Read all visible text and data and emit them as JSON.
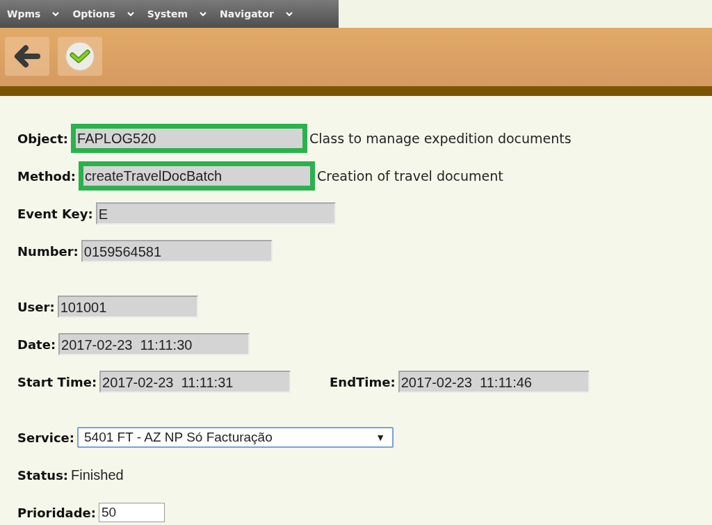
{
  "menu": [
    {
      "label": "Wpms"
    },
    {
      "label": "Options"
    },
    {
      "label": "System"
    },
    {
      "label": "Navigator"
    }
  ],
  "toolbar": {
    "buttons": [
      {
        "kind": "back"
      },
      {
        "kind": "confirm"
      }
    ]
  },
  "form": {
    "sections": [
      {
        "rows": [
          {
            "items": [
              {
                "label": "Object:",
                "kind": "readonly",
                "value": "FAPLOG520",
                "highlighted": true,
                "description": "Class to manage expedition documents"
              }
            ]
          },
          {
            "items": [
              {
                "label": "Method:",
                "kind": "readonly",
                "value": "createTravelDocBatch",
                "highlighted": true,
                "description": "Creation of travel document"
              }
            ]
          },
          {
            "items": [
              {
                "label": "Event Key:",
                "kind": "readonly",
                "value": "E",
                "highlighted": false
              }
            ]
          },
          {
            "items": [
              {
                "label": "Number:",
                "kind": "readonly",
                "value": "0159564581",
                "highlighted": false
              }
            ]
          }
        ]
      },
      {
        "rows": [
          {
            "items": [
              {
                "label": "User:",
                "kind": "readonly",
                "value": "101001",
                "highlighted": false
              }
            ]
          },
          {
            "items": [
              {
                "label": "Date:",
                "kind": "readonly",
                "value": "2017-02-23  11:11:30",
                "highlighted": false
              }
            ]
          },
          {
            "items": [
              {
                "label": "Start Time:",
                "kind": "readonly",
                "value": "2017-02-23  11:11:31",
                "highlighted": false
              },
              {
                "label": "EndTime:",
                "kind": "readonly",
                "value": "2017-02-23  11:11:46",
                "highlighted": false
              }
            ]
          }
        ]
      },
      {
        "rows": [
          {
            "items": [
              {
                "label": "Service:",
                "kind": "select",
                "value": "5401 FT - AZ NP Só Facturação",
                "arrow": "▼"
              }
            ]
          },
          {
            "items": [
              {
                "label": "Status:",
                "kind": "text",
                "value": "Finished"
              }
            ]
          },
          {
            "items": [
              {
                "label": "Prioridade:",
                "kind": "input",
                "value": "50"
              }
            ]
          }
        ]
      }
    ]
  }
}
